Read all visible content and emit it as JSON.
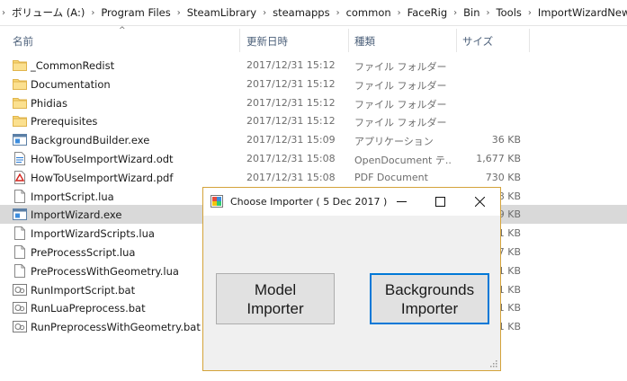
{
  "breadcrumb": [
    "ボリューム (A:)",
    "Program Files",
    "SteamLibrary",
    "steamapps",
    "common",
    "FaceRig",
    "Bin",
    "Tools",
    "ImportWizardNew"
  ],
  "breadcrumb_separator": "›",
  "columns": {
    "name": "名前",
    "date": "更新日時",
    "type": "種類",
    "size": "サイズ"
  },
  "files": [
    {
      "name": "_CommonRedist",
      "date": "2017/12/31 15:12",
      "type": "ファイル フォルダー",
      "size": "",
      "icon": "folder-icon"
    },
    {
      "name": "Documentation",
      "date": "2017/12/31 15:12",
      "type": "ファイル フォルダー",
      "size": "",
      "icon": "folder-icon"
    },
    {
      "name": "Phidias",
      "date": "2017/12/31 15:12",
      "type": "ファイル フォルダー",
      "size": "",
      "icon": "folder-icon"
    },
    {
      "name": "Prerequisites",
      "date": "2017/12/31 15:12",
      "type": "ファイル フォルダー",
      "size": "",
      "icon": "folder-icon"
    },
    {
      "name": "BackgroundBuilder.exe",
      "date": "2017/12/31 15:09",
      "type": "アプリケーション",
      "size": "36 KB",
      "icon": "exe-icon"
    },
    {
      "name": "HowToUseImportWizard.odt",
      "date": "2017/12/31 15:08",
      "type": "OpenDocument テ...",
      "size": "1,677 KB",
      "icon": "odt-icon"
    },
    {
      "name": "HowToUseImportWizard.pdf",
      "date": "2017/12/31 15:08",
      "type": "PDF Document",
      "size": "730 KB",
      "icon": "pdf-icon"
    },
    {
      "name": "ImportScript.lua",
      "date": "",
      "type": "",
      "size": "8 KB",
      "icon": "document-icon"
    },
    {
      "name": "ImportWizard.exe",
      "date": "",
      "type": "",
      "size": "9 KB",
      "icon": "exe-icon"
    },
    {
      "name": "ImportWizardScripts.lua",
      "date": "",
      "type": "",
      "size": "1 KB",
      "icon": "document-icon"
    },
    {
      "name": "PreProcessScript.lua",
      "date": "",
      "type": "",
      "size": "7 KB",
      "icon": "document-icon"
    },
    {
      "name": "PreProcessWithGeometry.lua",
      "date": "",
      "type": "",
      "size": "1 KB",
      "icon": "document-icon"
    },
    {
      "name": "RunImportScript.bat",
      "date": "",
      "type": "",
      "size": "1 KB",
      "icon": "bat-icon"
    },
    {
      "name": "RunLuaPreprocess.bat",
      "date": "",
      "type": "",
      "size": "1 KB",
      "icon": "bat-icon"
    },
    {
      "name": "RunPreprocessWithGeometry.bat",
      "date": "",
      "type": "",
      "size": "1 KB",
      "icon": "bat-icon"
    }
  ],
  "selected_file": "ImportWizard.exe",
  "dialog": {
    "title": "Choose Importer ( 5 Dec 2017 )",
    "model_button": {
      "line1": "Model",
      "line2": "Importer"
    },
    "backgrounds_button": {
      "line1": "Backgrounds",
      "line2": "Importer"
    }
  },
  "colors": {
    "folder": "#f8d775",
    "selected_row": "#d9d9d9",
    "dialog_border": "#d4a33a",
    "focus_border": "#0078d7",
    "dialog_bg": "#f0f0f0"
  }
}
